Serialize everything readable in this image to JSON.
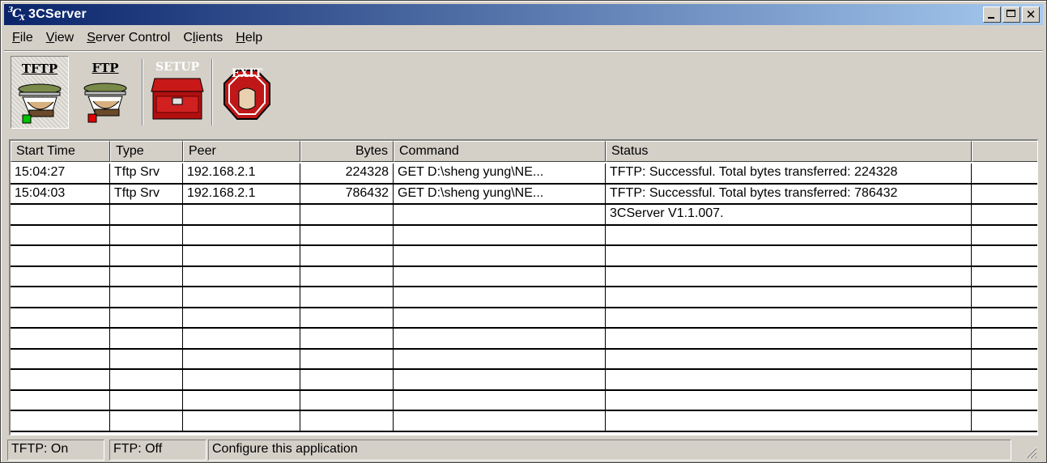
{
  "window": {
    "title": "3CServer",
    "icon": "3cx-logo-icon",
    "controls": [
      "minimize-icon",
      "maximize-icon",
      "close-icon"
    ],
    "title_gradient": [
      "#0a246a",
      "#a6caf0"
    ]
  },
  "menu": [
    {
      "label": "File"
    },
    {
      "label": "View"
    },
    {
      "label": "Server Control"
    },
    {
      "label": "Clients"
    },
    {
      "label": "Help"
    }
  ],
  "toolbar": [
    {
      "label": "TFTP",
      "icon": "tftp-server-icon",
      "pressed": true
    },
    {
      "label": "FTP",
      "icon": "ftp-server-icon",
      "pressed": false
    },
    {
      "label": "SETUP",
      "icon": "setup-toolbox-icon",
      "pressed": false
    },
    {
      "label": "EXIT",
      "icon": "exit-stop-icon",
      "pressed": false
    }
  ],
  "table": {
    "columns": [
      "Start Time",
      "Type",
      "Peer",
      "Bytes",
      "Command",
      "Status",
      ""
    ],
    "rows": [
      [
        "15:04:27",
        "Tftp Srv",
        "192.168.2.1",
        "224328",
        "GET D:\\sheng yung\\NE...",
        "TFTP: Successful. Total bytes transferred: 224328",
        ""
      ],
      [
        "15:04:03",
        "Tftp Srv",
        "192.168.2.1",
        "786432",
        "GET D:\\sheng yung\\NE...",
        "TFTP: Successful. Total bytes transferred: 786432",
        ""
      ],
      [
        "",
        "",
        "",
        "",
        "",
        "3CServer V1.1.007.",
        ""
      ],
      [
        "",
        "",
        "",
        "",
        "",
        "",
        ""
      ],
      [
        "",
        "",
        "",
        "",
        "",
        "",
        ""
      ],
      [
        "",
        "",
        "",
        "",
        "",
        "",
        ""
      ],
      [
        "",
        "",
        "",
        "",
        "",
        "",
        ""
      ],
      [
        "",
        "",
        "",
        "",
        "",
        "",
        ""
      ],
      [
        "",
        "",
        "",
        "",
        "",
        "",
        ""
      ],
      [
        "",
        "",
        "",
        "",
        "",
        "",
        ""
      ],
      [
        "",
        "",
        "",
        "",
        "",
        "",
        ""
      ],
      [
        "",
        "",
        "",
        "",
        "",
        "",
        ""
      ],
      [
        "",
        "",
        "",
        "",
        "",
        "",
        ""
      ]
    ]
  },
  "statusbar": {
    "tftp": "TFTP: On",
    "ftp": "FTP: Off",
    "message": "Configure this application"
  }
}
